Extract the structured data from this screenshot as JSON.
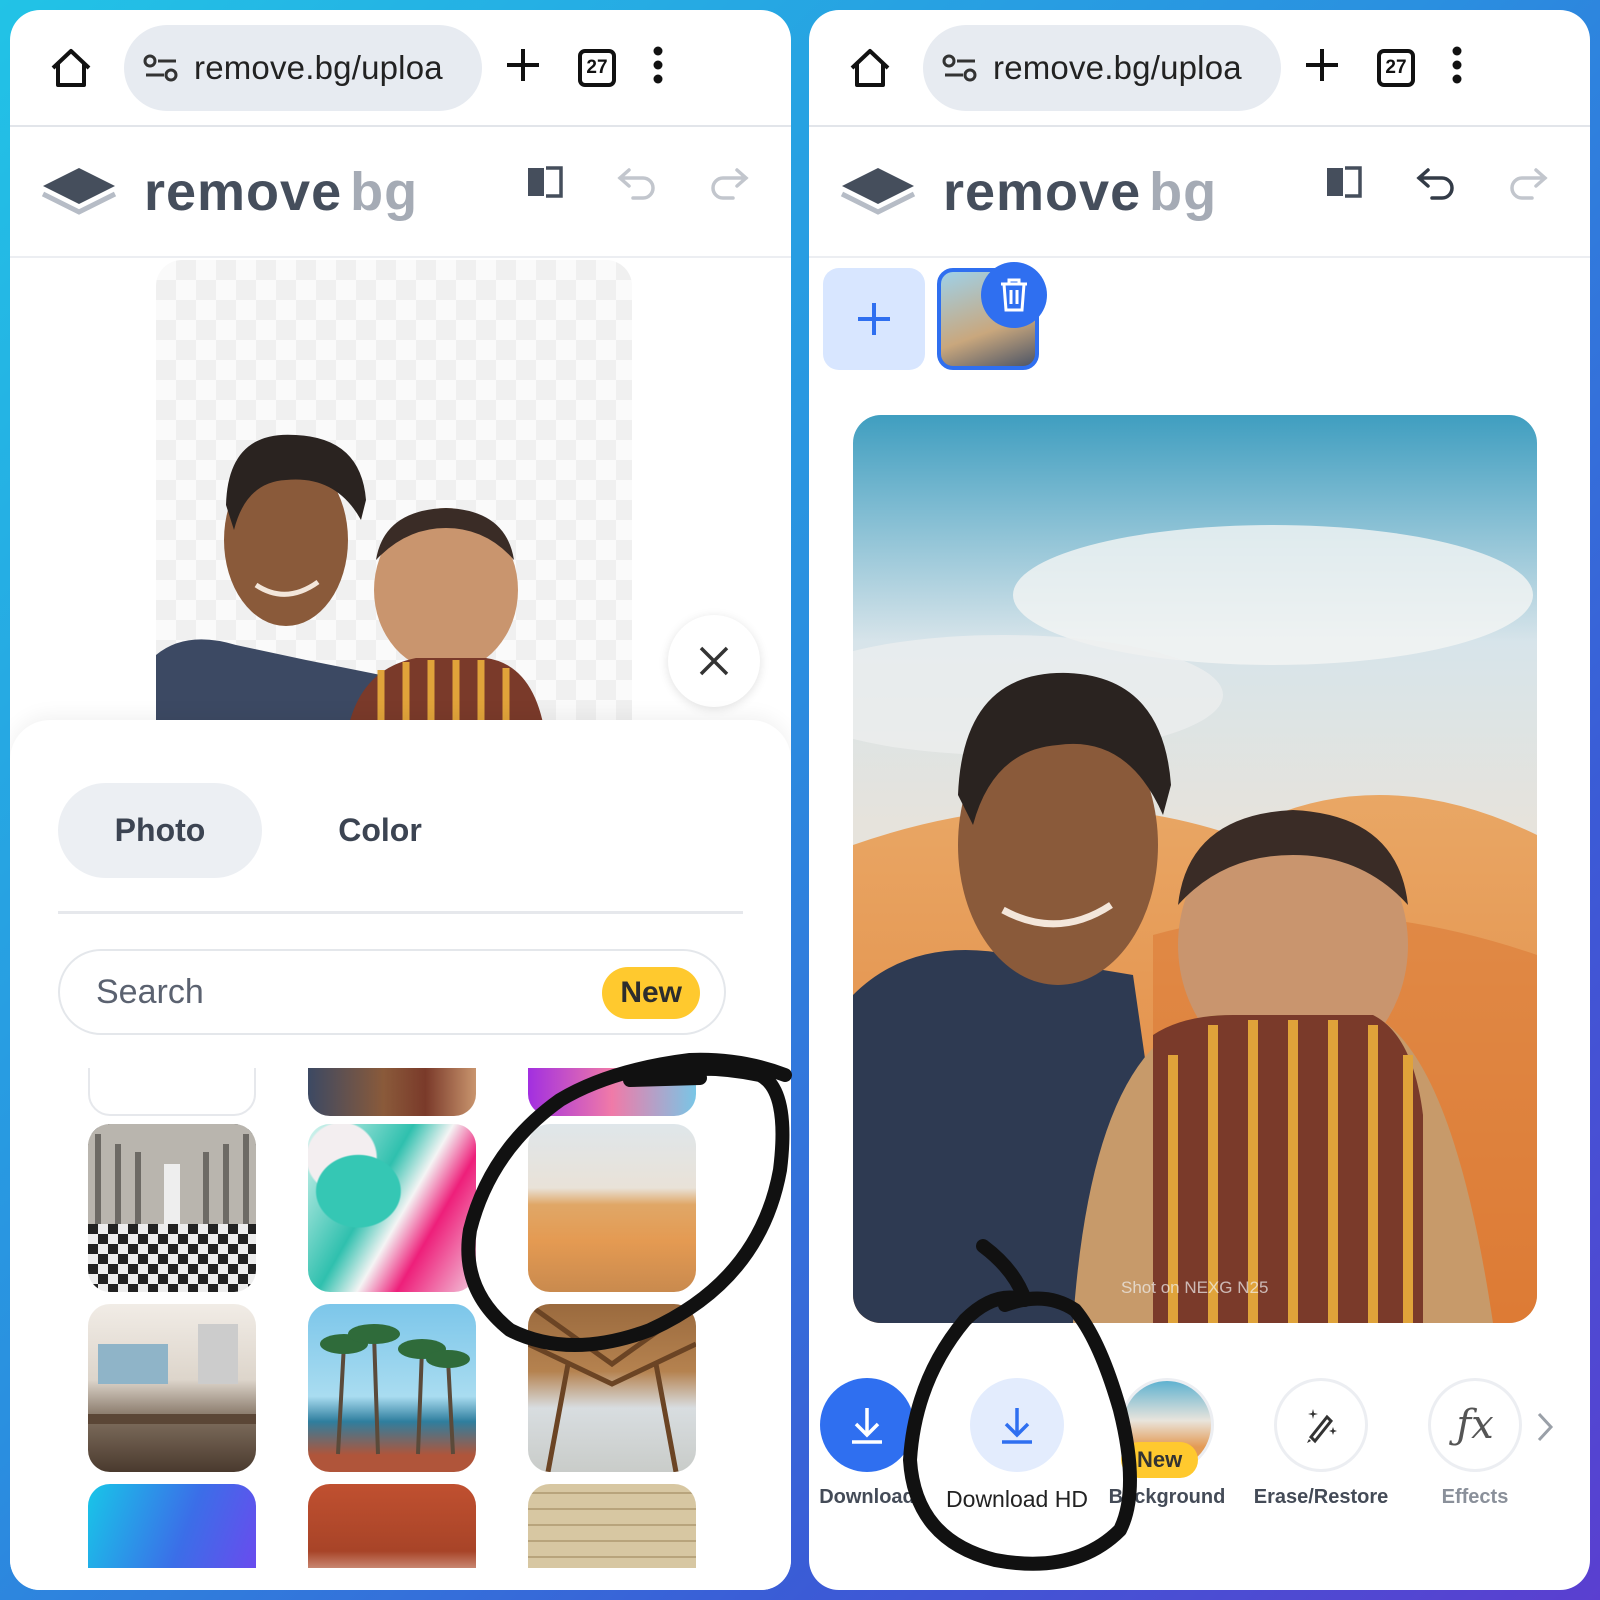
{
  "browser": {
    "url": "remove.bg/uploa",
    "tab_count": "27"
  },
  "app": {
    "logo_remove": "remove",
    "logo_bg": "bg"
  },
  "left_panel": {
    "tabs": [
      {
        "label": "Photo",
        "active": true
      },
      {
        "label": "Color",
        "active": false
      }
    ],
    "search": {
      "placeholder": "Search",
      "badge": "New"
    },
    "background_tiles": [
      "white",
      "selfie",
      "gradient-purple",
      "palace-hall",
      "pink-teal-marble",
      "desert-dunes",
      "cafe-interior",
      "palm-trees",
      "wooden-pavilion",
      "blue-purple-gradient",
      "red-rock-arch",
      "stone-wall"
    ]
  },
  "right_panel": {
    "watermark": "Shot on NEXG N25",
    "toolbar": [
      {
        "label": "Download",
        "icon": "download-icon",
        "style": "primary"
      },
      {
        "label": "Download HD",
        "icon": "download-icon",
        "style": "secondary"
      },
      {
        "label": "Background",
        "icon": "background-thumb",
        "badge": "New"
      },
      {
        "label": "Erase/Restore",
        "icon": "magic-brush-icon"
      },
      {
        "label": "Effects",
        "icon": "fx-icon"
      }
    ]
  },
  "colors": {
    "accent": "#2f6ff0",
    "badge_yellow": "#ffc92e",
    "annotation": "#111111"
  }
}
